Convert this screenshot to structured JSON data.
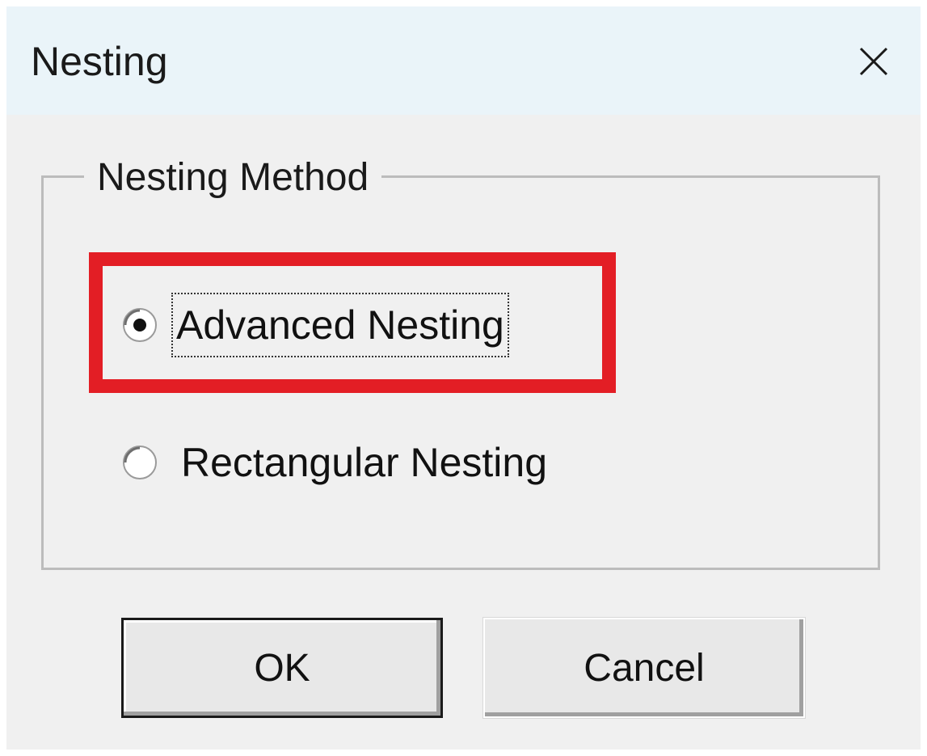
{
  "window": {
    "title": "Nesting"
  },
  "group": {
    "label": "Nesting Method",
    "options": [
      {
        "label": "Advanced Nesting",
        "selected": true,
        "highlighted": true
      },
      {
        "label": "Rectangular Nesting",
        "selected": false,
        "highlighted": false
      }
    ]
  },
  "buttons": {
    "ok_label": "OK",
    "cancel_label": "Cancel"
  },
  "colors": {
    "highlight": "#e31e25",
    "titlebar": "#eaf4f9",
    "dialog_bg": "#f0f0f0"
  },
  "icons": {
    "close": "close-icon"
  }
}
